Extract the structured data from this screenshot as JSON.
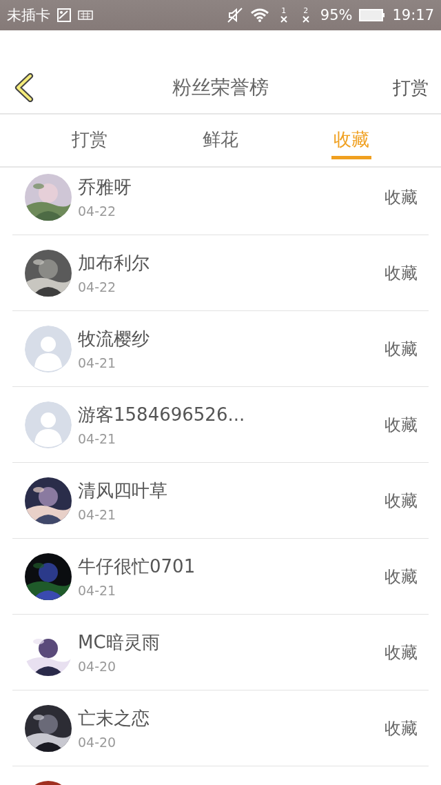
{
  "status_bar": {
    "carrier": "未插卡",
    "sims": [
      "1",
      "2"
    ],
    "battery": "95%",
    "time": "19:17"
  },
  "header": {
    "title": "粉丝荣誉榜",
    "action": "打赏"
  },
  "tabs": [
    {
      "label": "打赏",
      "selected": false
    },
    {
      "label": "鲜花",
      "selected": false
    },
    {
      "label": "收藏",
      "selected": true
    }
  ],
  "fans": [
    {
      "name": "乔雅呀",
      "date": "04-22",
      "action": "收藏",
      "kind": "picture"
    },
    {
      "name": "加布利尔",
      "date": "04-22",
      "action": "收藏",
      "kind": "picture"
    },
    {
      "name": "牧流樱纱",
      "date": "04-21",
      "action": "收藏",
      "kind": "default"
    },
    {
      "name": "游客1584696526...",
      "date": "04-21",
      "action": "收藏",
      "kind": "default"
    },
    {
      "name": "清风四叶草",
      "date": "04-21",
      "action": "收藏",
      "kind": "picture"
    },
    {
      "name": "牛仔很忙0701",
      "date": "04-21",
      "action": "收藏",
      "kind": "picture"
    },
    {
      "name": "MC暗灵雨",
      "date": "04-20",
      "action": "收藏",
      "kind": "picture"
    },
    {
      "name": "亡末之恋",
      "date": "04-20",
      "action": "收藏",
      "kind": "picture"
    },
    {
      "kind": "picture"
    }
  ]
}
